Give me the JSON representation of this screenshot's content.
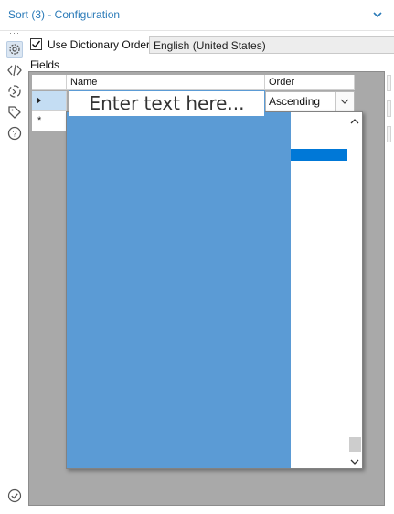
{
  "header": {
    "title": "Sort (3) - Configuration",
    "collapse_icon": "chevron-down-icon"
  },
  "sidebar": {
    "more_icon": "ellipsis-icon",
    "items": [
      {
        "icon": "gear-icon",
        "active": true
      },
      {
        "icon": "code-icon",
        "active": false
      },
      {
        "icon": "connection-icon",
        "active": false
      },
      {
        "icon": "tag-icon",
        "active": false
      },
      {
        "icon": "help-icon",
        "active": false
      }
    ],
    "bottom_icon": "check-circle-icon"
  },
  "options": {
    "use_dictionary_label": "Use Dictionary Order",
    "use_dictionary_checked": true,
    "language_value": "English (United States)"
  },
  "fields": {
    "label": "Fields",
    "columns": [
      "Name",
      "Order"
    ],
    "rows": [
      {
        "marker": "current-row-arrow",
        "order": "Ascending"
      },
      {
        "marker": "*",
        "order": ""
      }
    ]
  },
  "annotation": {
    "text": "Enter text here..."
  },
  "colors": {
    "accent": "#2a7ab8",
    "dropdown_fill": "#5b9bd5",
    "selection": "#0078d7",
    "grid_background": "#a9a9a9"
  }
}
